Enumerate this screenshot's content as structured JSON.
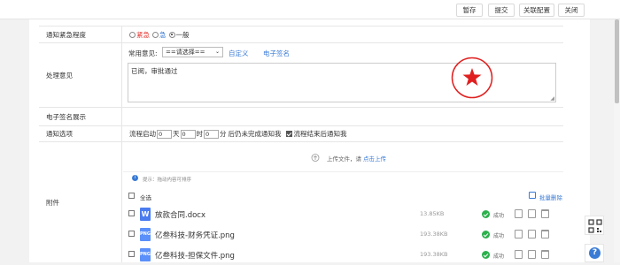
{
  "toolbar": {
    "save_draft": "暂存",
    "submit": "提交",
    "close_config": "关联配置",
    "close": "关闭"
  },
  "form": {
    "urgency": {
      "label": "通知紧急程度",
      "options": [
        "紧急",
        "急",
        "一般"
      ],
      "option_colors": [
        "#e53935",
        "#3a7bd5",
        "#333333"
      ],
      "selected": "一般"
    },
    "opinion": {
      "label": "处理意见",
      "common_label": "常用意见:",
      "select_value": "==请选择==",
      "custom_link": "自定义",
      "esign_link": "电子签名",
      "text": "已阅，审批通过"
    },
    "signature_display": {
      "label": "电子签名展示"
    },
    "notify": {
      "label": "通知选项",
      "prefix": "流程启动",
      "day_unit": "天",
      "hour_unit": "时",
      "minute_unit": "分",
      "suffix": "后仍未完成通知我",
      "day_value": "0",
      "hour_value": "0",
      "minute_value": "0",
      "end_notify_label": "流程结束后通知我",
      "end_notify_checked": true
    },
    "attachments": {
      "label": "附件",
      "upload_text": "上传文件，请",
      "upload_link": "点击上传",
      "hint": "提示：拖动内容可排序",
      "select_all": "全选",
      "batch_delete": "批量删除",
      "files": [
        {
          "name": "放款合同.docx",
          "size": "13.85KB",
          "status": "成功",
          "type": "W",
          "color": "#4a7cf0"
        },
        {
          "name": "亿叁科技-财务凭证.png",
          "size": "193.38KB",
          "status": "成功",
          "type": "PNG",
          "color": "#5b8ff9"
        },
        {
          "name": "亿叁科技-担保文件.png",
          "size": "193.38KB",
          "status": "成功",
          "type": "PNG",
          "color": "#5b8ff9"
        }
      ]
    }
  },
  "stamp": {
    "icon": "star-icon",
    "color": "#e02020"
  },
  "floating": {
    "qr": "qr-code-icon",
    "help": "help-icon"
  }
}
